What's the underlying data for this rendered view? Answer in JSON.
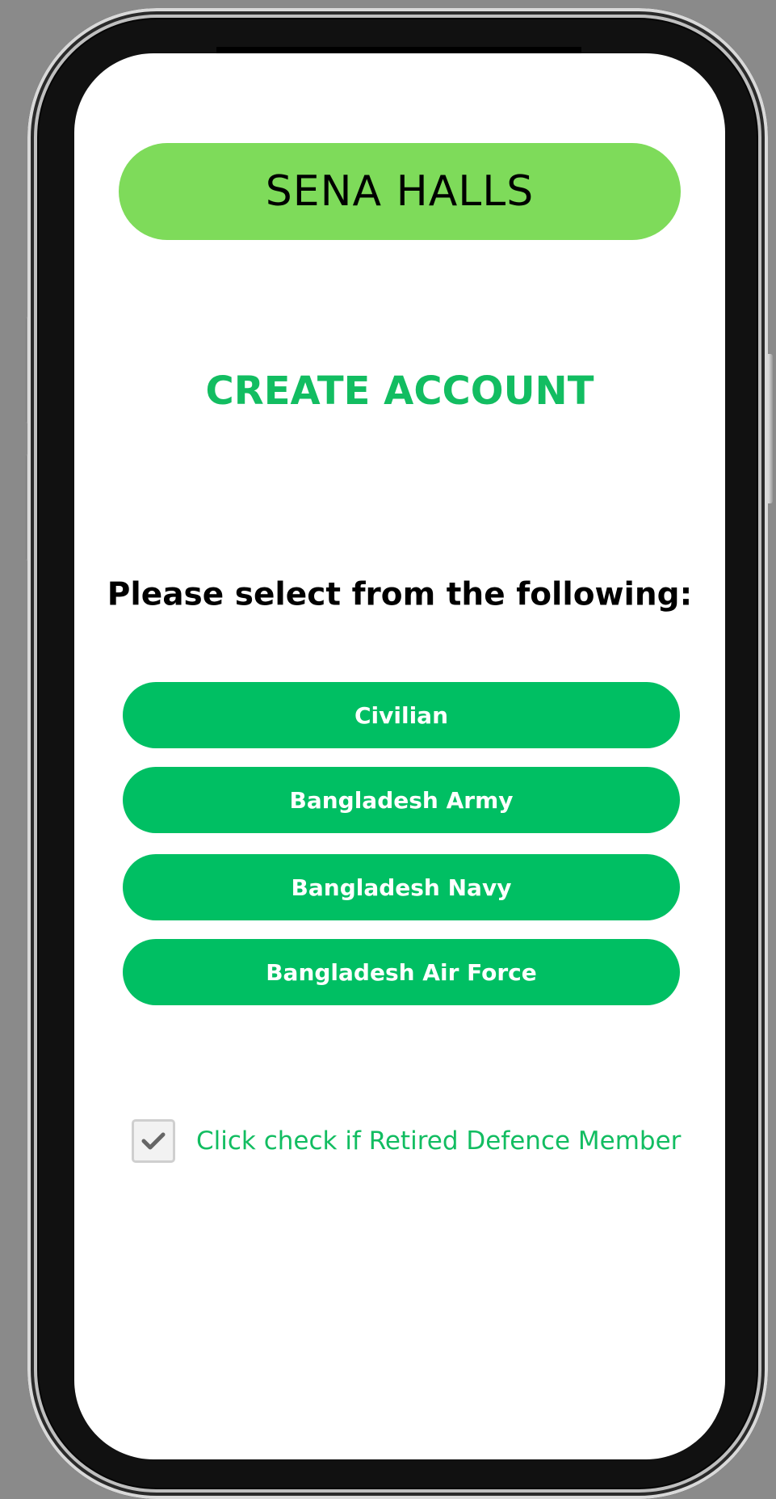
{
  "app": {
    "brand_title": "SENA HALLS"
  },
  "page": {
    "heading": "CREATE ACCOUNT",
    "prompt": "Please select from the following:"
  },
  "options": [
    {
      "label": "Civilian"
    },
    {
      "label": "Bangladesh Army"
    },
    {
      "label": "Bangladesh Navy"
    },
    {
      "label": "Bangladesh Air Force"
    }
  ],
  "retired": {
    "checked": true,
    "label": "Click check if Retired Defence Member",
    "icon": "check-icon"
  },
  "colors": {
    "brand_bar": "#7edb5a",
    "accent": "#00bf63",
    "heading": "#12bd61",
    "button_text": "#ffffff",
    "checkmark": "#666666"
  }
}
